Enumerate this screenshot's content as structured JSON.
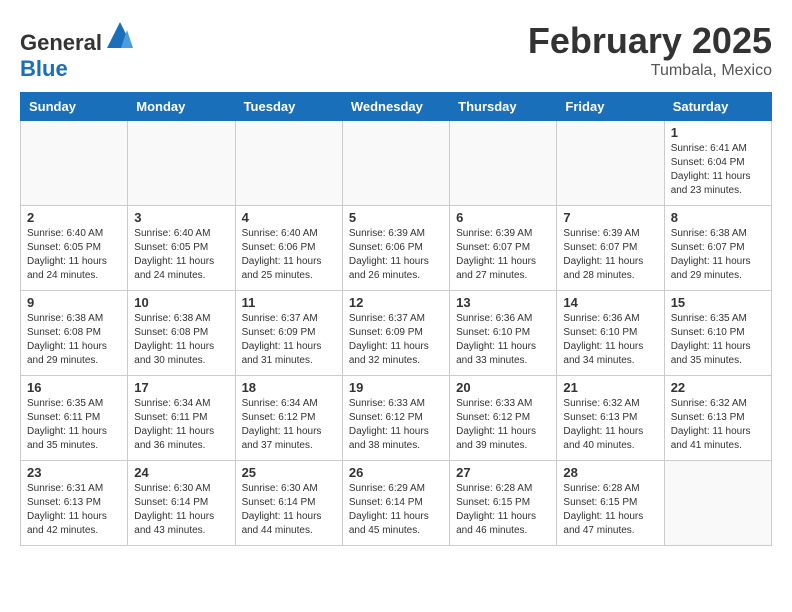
{
  "header": {
    "logo_general": "General",
    "logo_blue": "Blue",
    "month": "February 2025",
    "location": "Tumbala, Mexico"
  },
  "weekdays": [
    "Sunday",
    "Monday",
    "Tuesday",
    "Wednesday",
    "Thursday",
    "Friday",
    "Saturday"
  ],
  "weeks": [
    [
      {
        "day": "",
        "info": ""
      },
      {
        "day": "",
        "info": ""
      },
      {
        "day": "",
        "info": ""
      },
      {
        "day": "",
        "info": ""
      },
      {
        "day": "",
        "info": ""
      },
      {
        "day": "",
        "info": ""
      },
      {
        "day": "1",
        "info": "Sunrise: 6:41 AM\nSunset: 6:04 PM\nDaylight: 11 hours and 23 minutes."
      }
    ],
    [
      {
        "day": "2",
        "info": "Sunrise: 6:40 AM\nSunset: 6:05 PM\nDaylight: 11 hours and 24 minutes."
      },
      {
        "day": "3",
        "info": "Sunrise: 6:40 AM\nSunset: 6:05 PM\nDaylight: 11 hours and 24 minutes."
      },
      {
        "day": "4",
        "info": "Sunrise: 6:40 AM\nSunset: 6:06 PM\nDaylight: 11 hours and 25 minutes."
      },
      {
        "day": "5",
        "info": "Sunrise: 6:39 AM\nSunset: 6:06 PM\nDaylight: 11 hours and 26 minutes."
      },
      {
        "day": "6",
        "info": "Sunrise: 6:39 AM\nSunset: 6:07 PM\nDaylight: 11 hours and 27 minutes."
      },
      {
        "day": "7",
        "info": "Sunrise: 6:39 AM\nSunset: 6:07 PM\nDaylight: 11 hours and 28 minutes."
      },
      {
        "day": "8",
        "info": "Sunrise: 6:38 AM\nSunset: 6:07 PM\nDaylight: 11 hours and 29 minutes."
      }
    ],
    [
      {
        "day": "9",
        "info": "Sunrise: 6:38 AM\nSunset: 6:08 PM\nDaylight: 11 hours and 29 minutes."
      },
      {
        "day": "10",
        "info": "Sunrise: 6:38 AM\nSunset: 6:08 PM\nDaylight: 11 hours and 30 minutes."
      },
      {
        "day": "11",
        "info": "Sunrise: 6:37 AM\nSunset: 6:09 PM\nDaylight: 11 hours and 31 minutes."
      },
      {
        "day": "12",
        "info": "Sunrise: 6:37 AM\nSunset: 6:09 PM\nDaylight: 11 hours and 32 minutes."
      },
      {
        "day": "13",
        "info": "Sunrise: 6:36 AM\nSunset: 6:10 PM\nDaylight: 11 hours and 33 minutes."
      },
      {
        "day": "14",
        "info": "Sunrise: 6:36 AM\nSunset: 6:10 PM\nDaylight: 11 hours and 34 minutes."
      },
      {
        "day": "15",
        "info": "Sunrise: 6:35 AM\nSunset: 6:10 PM\nDaylight: 11 hours and 35 minutes."
      }
    ],
    [
      {
        "day": "16",
        "info": "Sunrise: 6:35 AM\nSunset: 6:11 PM\nDaylight: 11 hours and 35 minutes."
      },
      {
        "day": "17",
        "info": "Sunrise: 6:34 AM\nSunset: 6:11 PM\nDaylight: 11 hours and 36 minutes."
      },
      {
        "day": "18",
        "info": "Sunrise: 6:34 AM\nSunset: 6:12 PM\nDaylight: 11 hours and 37 minutes."
      },
      {
        "day": "19",
        "info": "Sunrise: 6:33 AM\nSunset: 6:12 PM\nDaylight: 11 hours and 38 minutes."
      },
      {
        "day": "20",
        "info": "Sunrise: 6:33 AM\nSunset: 6:12 PM\nDaylight: 11 hours and 39 minutes."
      },
      {
        "day": "21",
        "info": "Sunrise: 6:32 AM\nSunset: 6:13 PM\nDaylight: 11 hours and 40 minutes."
      },
      {
        "day": "22",
        "info": "Sunrise: 6:32 AM\nSunset: 6:13 PM\nDaylight: 11 hours and 41 minutes."
      }
    ],
    [
      {
        "day": "23",
        "info": "Sunrise: 6:31 AM\nSunset: 6:13 PM\nDaylight: 11 hours and 42 minutes."
      },
      {
        "day": "24",
        "info": "Sunrise: 6:30 AM\nSunset: 6:14 PM\nDaylight: 11 hours and 43 minutes."
      },
      {
        "day": "25",
        "info": "Sunrise: 6:30 AM\nSunset: 6:14 PM\nDaylight: 11 hours and 44 minutes."
      },
      {
        "day": "26",
        "info": "Sunrise: 6:29 AM\nSunset: 6:14 PM\nDaylight: 11 hours and 45 minutes."
      },
      {
        "day": "27",
        "info": "Sunrise: 6:28 AM\nSunset: 6:15 PM\nDaylight: 11 hours and 46 minutes."
      },
      {
        "day": "28",
        "info": "Sunrise: 6:28 AM\nSunset: 6:15 PM\nDaylight: 11 hours and 47 minutes."
      },
      {
        "day": "",
        "info": ""
      }
    ]
  ]
}
